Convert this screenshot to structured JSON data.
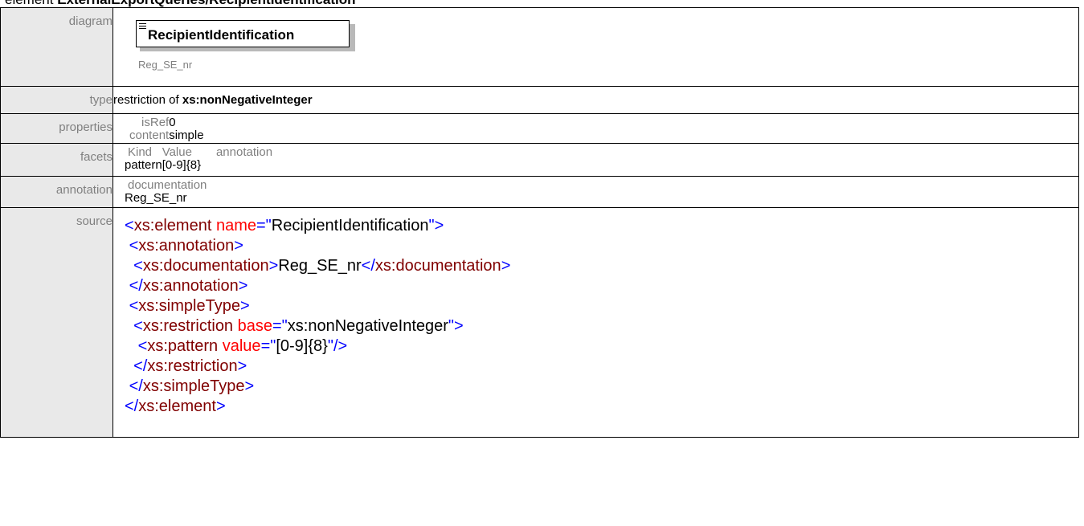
{
  "page": {
    "heading_prefix": "element",
    "heading_path": "ExternalExportQueries/RecipientIdentification"
  },
  "rows": {
    "diagram": {
      "label": "diagram",
      "element_name": "RecipientIdentification",
      "documentation": "Reg_SE_nr"
    },
    "type": {
      "label": "type",
      "prefix": "restriction of",
      "base": "xs:nonNegativeInteger"
    },
    "properties": {
      "label": "properties",
      "items": [
        {
          "key": "isRef",
          "value": "0"
        },
        {
          "key": "content",
          "value": "simple"
        }
      ]
    },
    "facets": {
      "label": "facets",
      "headers": [
        "Kind",
        "Value",
        "annotation"
      ],
      "kind": "pattern",
      "value": "[0-9]{8}"
    },
    "annotation": {
      "label": "annotation",
      "header": "documentation",
      "value": "Reg_SE_nr"
    },
    "source": {
      "label": "source",
      "lines": [
        {
          "indent": "",
          "open": "<",
          "tag": "xs:element",
          "attr": " name",
          "eq": "=\"",
          "attrval": "RecipientIdentification",
          "close": "\">",
          "text": "",
          "endtag": ""
        },
        {
          "indent": " ",
          "open": "<",
          "tag": "xs:annotation",
          "attr": "",
          "eq": "",
          "attrval": "",
          "close": ">",
          "text": "",
          "endtag": ""
        },
        {
          "indent": "  ",
          "open": "<",
          "tag": "xs:documentation",
          "attr": "",
          "eq": "",
          "attrval": "",
          "close": ">",
          "text": "Reg_SE_nr",
          "endtag": "xs:documentation"
        },
        {
          "indent": " ",
          "open": "</",
          "tag": "xs:annotation",
          "attr": "",
          "eq": "",
          "attrval": "",
          "close": ">",
          "text": "",
          "endtag": ""
        },
        {
          "indent": " ",
          "open": "<",
          "tag": "xs:simpleType",
          "attr": "",
          "eq": "",
          "attrval": "",
          "close": ">",
          "text": "",
          "endtag": ""
        },
        {
          "indent": "  ",
          "open": "<",
          "tag": "xs:restriction",
          "attr": " base",
          "eq": "=\"",
          "attrval": "xs:nonNegativeInteger",
          "close": "\">",
          "text": "",
          "endtag": ""
        },
        {
          "indent": "   ",
          "open": "<",
          "tag": "xs:pattern",
          "attr": " value",
          "eq": "=\"",
          "attrval": "[0-9]{8}",
          "close": "\"/>",
          "text": "",
          "endtag": ""
        },
        {
          "indent": "  ",
          "open": "</",
          "tag": "xs:restriction",
          "attr": "",
          "eq": "",
          "attrval": "",
          "close": ">",
          "text": "",
          "endtag": ""
        },
        {
          "indent": " ",
          "open": "</",
          "tag": "xs:simpleType",
          "attr": "",
          "eq": "",
          "attrval": "",
          "close": ">",
          "text": "",
          "endtag": ""
        },
        {
          "indent": "",
          "open": "</",
          "tag": "xs:element",
          "attr": "",
          "eq": "",
          "attrval": "",
          "close": ">",
          "text": "",
          "endtag": ""
        }
      ]
    }
  }
}
